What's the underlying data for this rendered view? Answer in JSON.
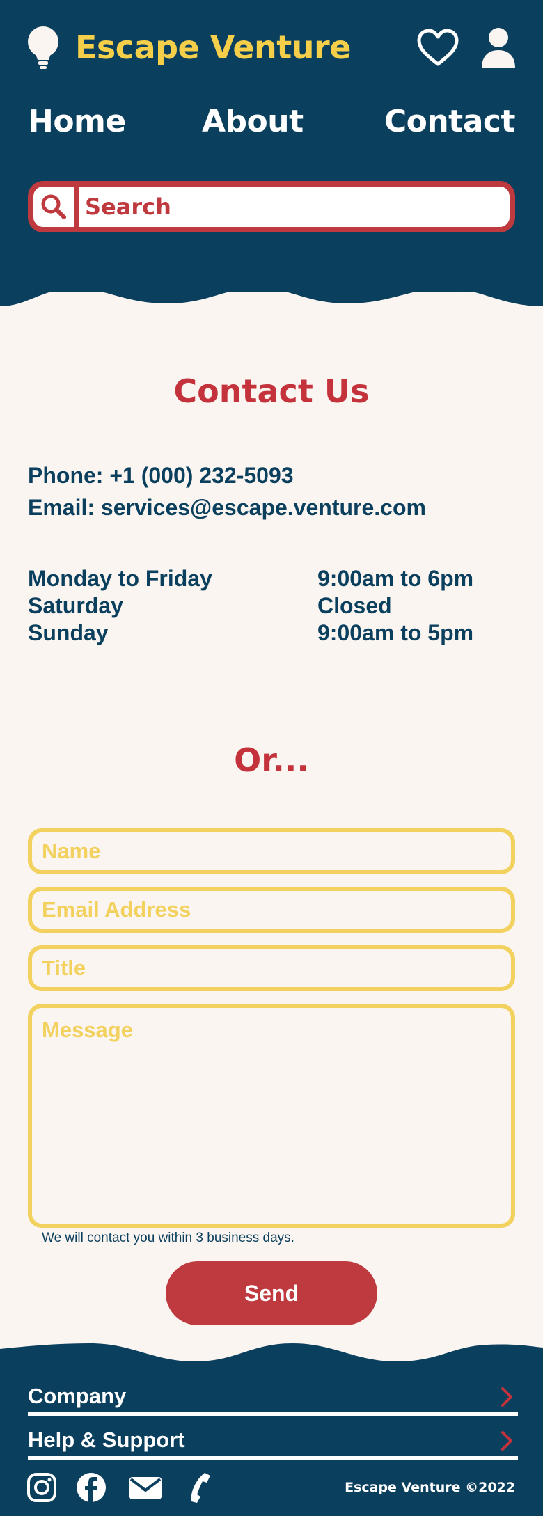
{
  "header": {
    "brand": "Escape Venture",
    "nav": [
      "Home",
      "About",
      "Contact"
    ],
    "search_placeholder": "Search"
  },
  "contact": {
    "title": "Contact Us",
    "phone": "Phone: +1 (000) 232-5093",
    "email": "Email: services@escape.venture.com",
    "hours": [
      {
        "day": "Monday to Friday",
        "time": "9:00am to 6pm"
      },
      {
        "day": "Saturday",
        "time": "Closed"
      },
      {
        "day": "Sunday",
        "time": "9:00am to 5pm"
      }
    ]
  },
  "form": {
    "or_heading": "Or...",
    "name_placeholder": "Name",
    "email_placeholder": "Email Address",
    "title_placeholder": "Title",
    "message_placeholder": "Message",
    "note": "We will contact you within 3 business days.",
    "send_label": "Send"
  },
  "footer": {
    "company": "Company",
    "help": "Help & Support",
    "copyright": "Escape Venture ©2022"
  },
  "icons": {
    "logo": "lightbulb-icon",
    "heart": "heart-icon",
    "user": "user-icon",
    "search": "search-icon",
    "chevron": "chevron-right-icon",
    "social": [
      "instagram-icon",
      "facebook-icon",
      "mail-icon",
      "phone-icon"
    ]
  },
  "colors": {
    "navy": "#0b3f5e",
    "yellow": "#f6cf4a",
    "red": "#bf3a3f",
    "cream": "#faf5f0"
  }
}
